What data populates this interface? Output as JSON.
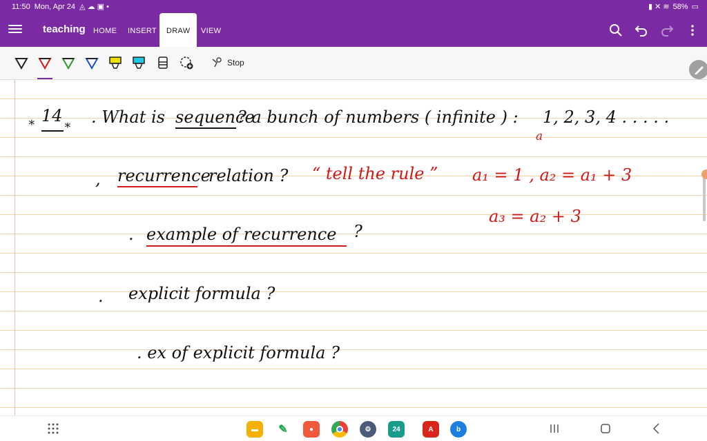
{
  "status": {
    "time": "11:50",
    "date": "Mon, Apr 24",
    "battery": "58%"
  },
  "appbar": {
    "notebook": "teaching",
    "tabs": [
      "HOME",
      "INSERT",
      "DRAW",
      "VIEW"
    ],
    "active_tab": "DRAW"
  },
  "toolbar": {
    "stop_label": "Stop",
    "pens": [
      {
        "name": "pen-black",
        "color": "#222222"
      },
      {
        "name": "pen-red",
        "color": "#d01818"
      },
      {
        "name": "pen-green",
        "color": "#2a9a2a"
      },
      {
        "name": "pen-blue",
        "color": "#2050c0"
      },
      {
        "name": "highlighter-yellow",
        "color": "#f0e000"
      },
      {
        "name": "highlighter-cyan",
        "color": "#20c8e0"
      }
    ]
  },
  "notes": {
    "line1_num": "14",
    "line1_text_a": ". What is",
    "line1_sequence": "sequence",
    "line1_text_b": "?  a bunch of numbers ( infinite ) :",
    "line1_seq": "1, 2, 3, 4 . . . . .",
    "line1_a": "a",
    "line2_recurrence": "recurrence",
    "line2_text": "relation ?",
    "line2_quote": "“ tell the rule ”",
    "line2_formula": "a₁ = 1 , a₂ = a₁ + 3",
    "line3_formula": "a₃ = a₂ + 3",
    "line3_text": "example of recurrence",
    "line3_q": "?",
    "line4_text": "explicit formula ?",
    "line5_text": ". ex of explicit formula ?"
  },
  "colors": {
    "accent": "#7a2ba4",
    "ink_red": "#d01818",
    "ink_black": "#111111"
  }
}
